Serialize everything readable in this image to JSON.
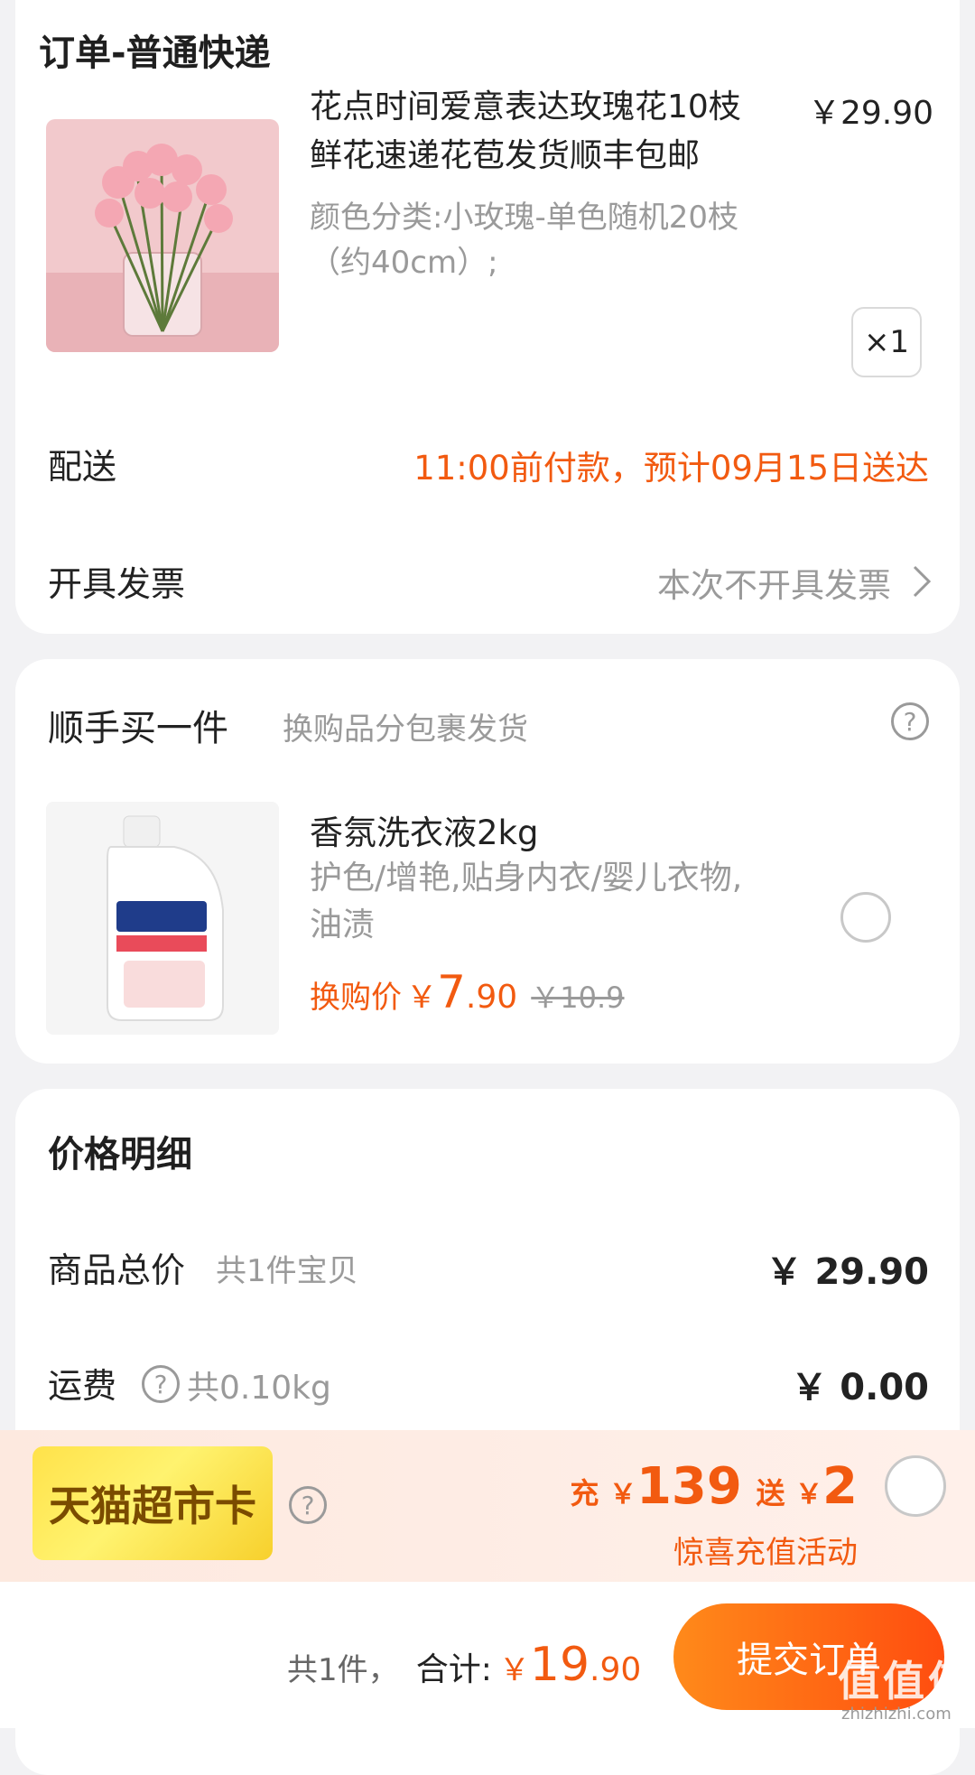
{
  "order": {
    "title": "订单-普通快递",
    "product": {
      "name_line1": "花点时间爱意表达玫瑰花10枝",
      "name_line2": "鲜花速递花苞发货顺丰包邮",
      "price": "￥29.90",
      "sku_line1": "颜色分类:小玫瑰-单色随机20枝",
      "sku_line2": "（约40cm）;",
      "quantity": "×1"
    },
    "delivery": {
      "label": "配送",
      "value": "11:00前付款，预计09月15日送达"
    },
    "invoice": {
      "label": "开具发票",
      "value": "本次不开具发票"
    }
  },
  "addon": {
    "title": "顺手买一件",
    "subtitle": "换购品分包裹发货",
    "product": {
      "name": "香氛洗衣液2kg",
      "desc_line1": "护色/增艳,贴身内衣/婴儿衣物,",
      "desc_line2": "油渍",
      "price_label": "换购价",
      "currency": "￥",
      "price_int": "7",
      "price_dec": ".90",
      "original_price": "￥10.9"
    }
  },
  "price_detail": {
    "title": "价格明细",
    "goods_total_label": "商品总价",
    "goods_total_note": "共1件宝贝",
    "goods_total_value": "￥ 29.90",
    "shipping_label": "运费",
    "shipping_weight": "共0.10kg",
    "shipping_value": "￥ 0.00"
  },
  "promo": {
    "card_name": "天猫超市卡",
    "charge_label": "充",
    "charge_currency": "￥",
    "charge_amount": "139",
    "bonus_label": "送",
    "bonus_currency": "￥",
    "bonus_amount": "2",
    "activity": "惊喜充值活动"
  },
  "footer": {
    "count": "共1件，",
    "total_label": "合计:",
    "currency": "￥",
    "total_int": "19",
    "total_dec": ".90",
    "submit_label": "提交订单",
    "watermark": "值 值 值",
    "watermark_url": "zhizhizhi.com"
  },
  "colors": {
    "accent": "#f25a10",
    "submit_gradient_start": "#ff8a1a",
    "submit_gradient_end": "#ff4d0f"
  }
}
